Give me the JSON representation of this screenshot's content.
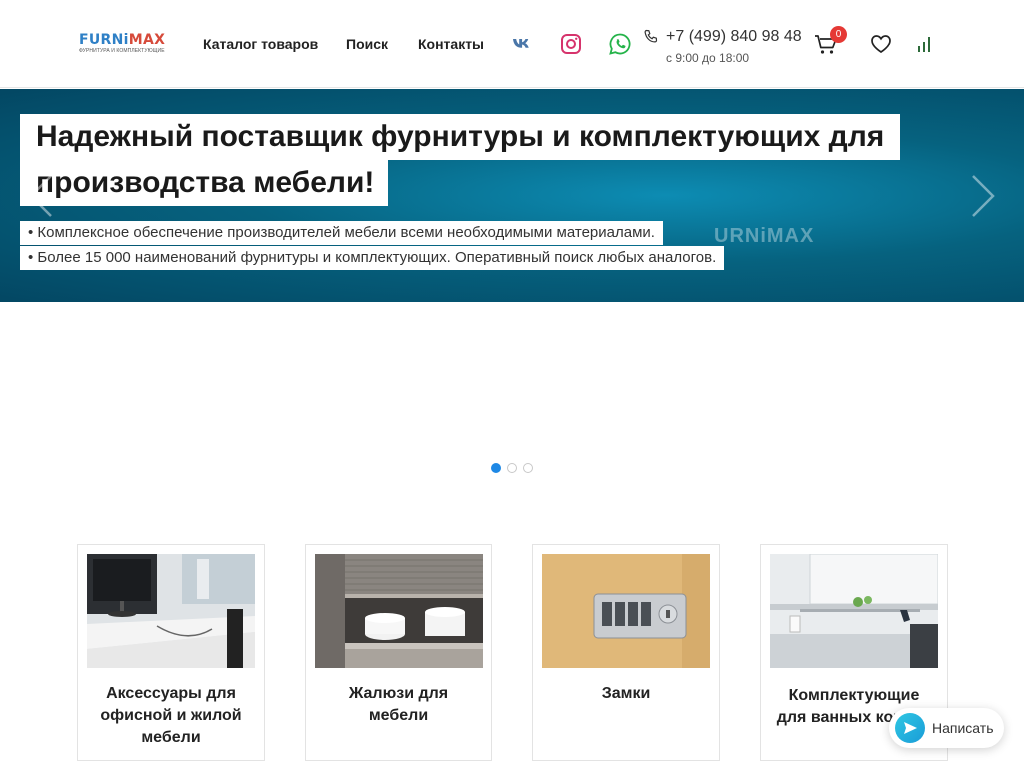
{
  "brand": {
    "logo_part1": "FURNi",
    "logo_part2": "MAX",
    "logo_tagline": "ФУРНИТУРА И КОМПЛЕКТУЮЩИЕ",
    "colors": {
      "blue": "#2f80c6",
      "red": "#d64a3a"
    }
  },
  "nav": {
    "items": [
      {
        "label": "Каталог товаров"
      },
      {
        "label": "Поиск"
      },
      {
        "label": "Контакты"
      }
    ]
  },
  "social": [
    "vk-icon",
    "instagram-icon",
    "whatsapp-icon"
  ],
  "contact": {
    "phone": "+7 (499) 840 98 48",
    "hours": "с 9:00 до 18:00"
  },
  "cart": {
    "count": "0"
  },
  "hero": {
    "title_line1": "Надежный поставщик фурнитуры и комплектующих для",
    "title_line2": "производства мебели!",
    "bullet1": "• Комплексное обеспечение производителей мебели всеми необходимыми материалами.",
    "bullet2": "• Более 15 000 наименований фурнитуры и комплектующих. Оперативный поиск любых аналогов.",
    "watermark": "URNiMAX",
    "slides_total": 3,
    "slide_active": 1
  },
  "categories": [
    {
      "title": "Аксессуары для офисной и жилой мебели"
    },
    {
      "title": "Жалюзи для мебели"
    },
    {
      "title": "Замки"
    },
    {
      "title": "Комплектующие для ванных комнат"
    }
  ],
  "chat": {
    "label": "Написать"
  },
  "colors": {
    "accent": "#1e88e5",
    "badge": "#e53935",
    "hero_dark": "#034763",
    "hero_light": "#0d8cb3"
  }
}
